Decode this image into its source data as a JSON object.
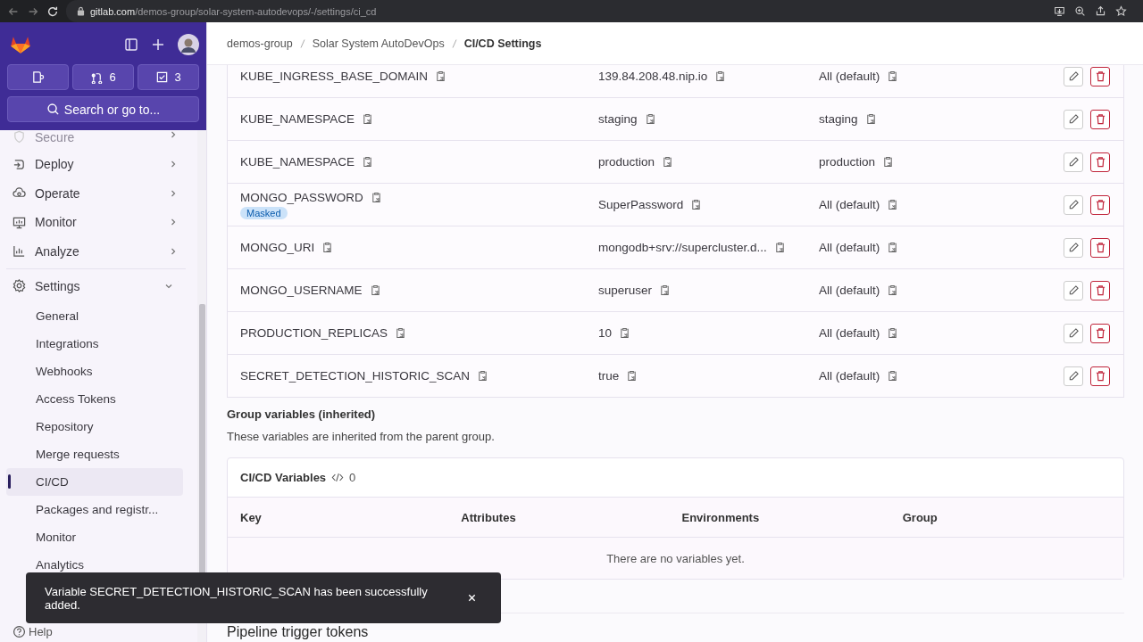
{
  "browser": {
    "url_host": "gitlab.com",
    "url_path": "/demos-group/solar-system-autodevops/-/settings/ci_cd"
  },
  "sidebar": {
    "shortcuts": [
      {
        "kind": "issues"
      },
      {
        "kind": "merge_requests",
        "count": "6"
      },
      {
        "kind": "todos",
        "count": "3"
      }
    ],
    "search_label": "Search or go to...",
    "nav": [
      {
        "label": "Secure",
        "kind": "faded",
        "expanded": false
      },
      {
        "label": "Deploy",
        "kind": "section",
        "expanded": false
      },
      {
        "label": "Operate",
        "kind": "section",
        "expanded": false
      },
      {
        "label": "Monitor",
        "kind": "section",
        "expanded": false
      },
      {
        "label": "Analyze",
        "kind": "section",
        "expanded": false
      },
      {
        "label": "Settings",
        "kind": "section",
        "expanded": true,
        "children": [
          {
            "label": "General",
            "selected": false
          },
          {
            "label": "Integrations",
            "selected": false
          },
          {
            "label": "Webhooks",
            "selected": false
          },
          {
            "label": "Access Tokens",
            "selected": false
          },
          {
            "label": "Repository",
            "selected": false
          },
          {
            "label": "Merge requests",
            "selected": false
          },
          {
            "label": "CI/CD",
            "selected": true
          },
          {
            "label": "Packages and registr...",
            "selected": false
          },
          {
            "label": "Monitor",
            "selected": false
          },
          {
            "label": "Analytics",
            "selected": false
          }
        ]
      }
    ],
    "help": "Help"
  },
  "breadcrumbs": [
    "demos-group",
    "Solar System AutoDevOps",
    "CI/CD Settings"
  ],
  "variables": [
    {
      "key": "KUBE_INGRESS_BASE_DOMAIN",
      "value": "139.84.208.48.nip.io",
      "environment": "All (default)",
      "masked": false
    },
    {
      "key": "KUBE_NAMESPACE",
      "value": "staging",
      "environment": "staging",
      "masked": false
    },
    {
      "key": "KUBE_NAMESPACE",
      "value": "production",
      "environment": "production",
      "masked": false
    },
    {
      "key": "MONGO_PASSWORD",
      "value": "SuperPassword",
      "environment": "All (default)",
      "masked": true,
      "masked_label": "Masked"
    },
    {
      "key": "MONGO_URI",
      "value": "mongodb+srv://supercluster.d...",
      "environment": "All (default)",
      "masked": false
    },
    {
      "key": "MONGO_USERNAME",
      "value": "superuser",
      "environment": "All (default)",
      "masked": false
    },
    {
      "key": "PRODUCTION_REPLICAS",
      "value": "10",
      "environment": "All (default)",
      "masked": false
    },
    {
      "key": "SECRET_DETECTION_HISTORIC_SCAN",
      "value": "true",
      "environment": "All (default)",
      "masked": false
    }
  ],
  "group_variables": {
    "title": "Group variables (inherited)",
    "description": "These variables are inherited from the parent group.",
    "card_title": "CI/CD Variables",
    "count": "0",
    "columns": [
      "Key",
      "Attributes",
      "Environments",
      "Group"
    ],
    "empty_text": "There are no variables yet."
  },
  "next_section": {
    "title": "Pipeline trigger tokens"
  },
  "toast": {
    "message": "Variable SECRET_DETECTION_HISTORIC_SCAN has been successfully added."
  }
}
